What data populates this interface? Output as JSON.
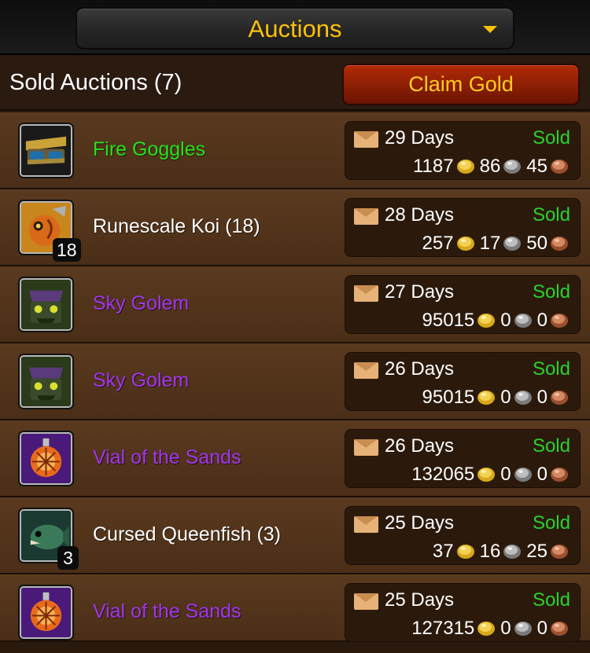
{
  "topbar": {
    "title": "Auctions",
    "dropdown_icon": "chevron-down-icon"
  },
  "header": {
    "title": "Sold Auctions (7)",
    "claim_label": "Claim Gold"
  },
  "colors": {
    "accent": "#ffc107",
    "sold": "#2bd22b",
    "quality_uncommon": "#27e21a",
    "quality_common": "#ffffff",
    "quality_epic": "#a335ee"
  },
  "auctions": [
    {
      "name": "Fire Goggles",
      "quality": "green",
      "icon": "goggles-icon",
      "stack": "",
      "days": "29 Days",
      "status": "Sold",
      "gold": "1187",
      "silver": "86",
      "copper": "45"
    },
    {
      "name": "Runescale Koi (18)",
      "quality": "white",
      "icon": "fish-icon",
      "stack": "18",
      "days": "28 Days",
      "status": "Sold",
      "gold": "257",
      "silver": "17",
      "copper": "50"
    },
    {
      "name": "Sky Golem",
      "quality": "purple",
      "icon": "golem-icon",
      "stack": "",
      "days": "27 Days",
      "status": "Sold",
      "gold": "95015",
      "silver": "0",
      "copper": "0"
    },
    {
      "name": "Sky Golem",
      "quality": "purple",
      "icon": "golem-icon",
      "stack": "",
      "days": "26 Days",
      "status": "Sold",
      "gold": "95015",
      "silver": "0",
      "copper": "0"
    },
    {
      "name": "Vial of the Sands",
      "quality": "purple",
      "icon": "vial-icon",
      "stack": "",
      "days": "26 Days",
      "status": "Sold",
      "gold": "132065",
      "silver": "0",
      "copper": "0"
    },
    {
      "name": "Cursed Queenfish (3)",
      "quality": "white",
      "icon": "queenfish-icon",
      "stack": "3",
      "days": "25 Days",
      "status": "Sold",
      "gold": "37",
      "silver": "16",
      "copper": "25"
    },
    {
      "name": "Vial of the Sands",
      "quality": "purple",
      "icon": "vial-icon",
      "stack": "",
      "days": "25 Days",
      "status": "Sold",
      "gold": "127315",
      "silver": "0",
      "copper": "0"
    }
  ]
}
